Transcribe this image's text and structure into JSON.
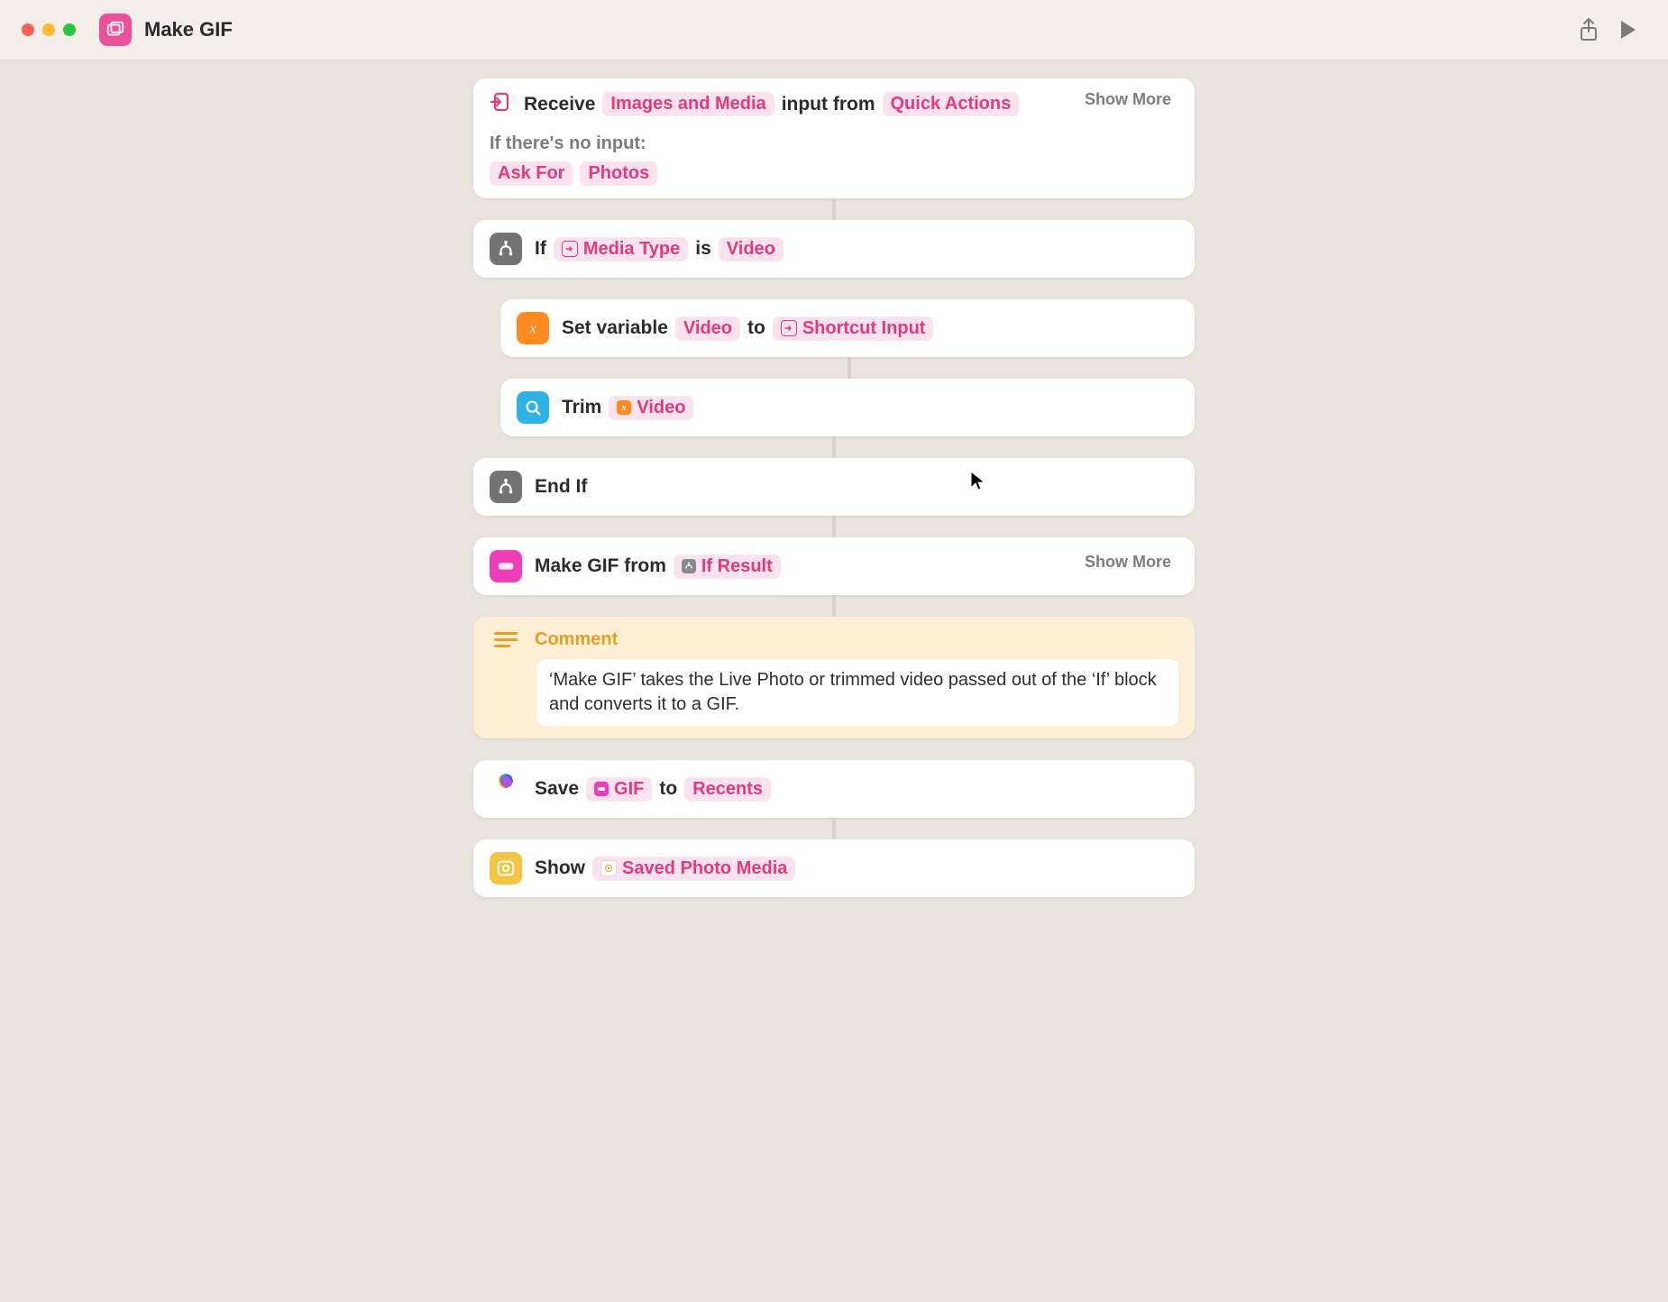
{
  "window": {
    "title": "Make GIF"
  },
  "actions": {
    "receive": {
      "prefix": "Receive",
      "type_token": "Images and Media",
      "mid": "input from",
      "source_token": "Quick Actions",
      "no_input_label": "If there's no input:",
      "fallback_action": "Ask For",
      "fallback_value": "Photos",
      "show_more": "Show More"
    },
    "if": {
      "label": "If",
      "var_token": "Media Type",
      "op": "is",
      "value_token": "Video"
    },
    "set_var": {
      "prefix": "Set variable",
      "name_token": "Video",
      "mid": "to",
      "value_token": "Shortcut Input"
    },
    "trim": {
      "label": "Trim",
      "value_token": "Video"
    },
    "endif": {
      "label": "End If"
    },
    "make_gif": {
      "prefix": "Make GIF from",
      "value_token": "If Result",
      "show_more": "Show More"
    },
    "comment": {
      "title": "Comment",
      "body": "‘Make GIF’ takes the Live Photo or trimmed video passed out of the ‘If’ block and converts it to a GIF."
    },
    "save": {
      "prefix": "Save",
      "value_token": "GIF",
      "mid": "to",
      "dest_token": "Recents"
    },
    "show": {
      "prefix": "Show",
      "value_token": "Saved Photo Media"
    }
  }
}
